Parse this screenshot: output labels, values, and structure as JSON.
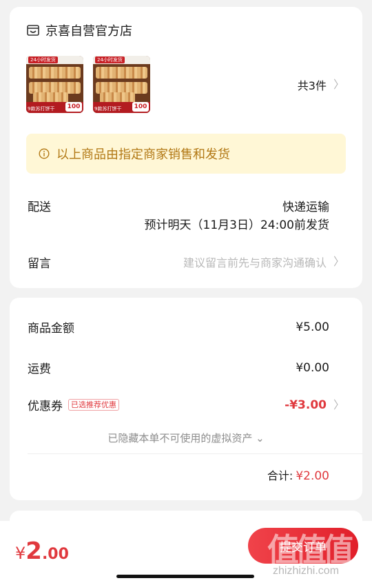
{
  "shop": {
    "name": "京喜自营官方店",
    "icon": "shop-icon",
    "item_count": "共3件",
    "products": [
      {
        "tag": "24小时发货",
        "label": "9款苏打饼干",
        "badge": "100"
      },
      {
        "tag": "24小时发货",
        "label": "9款苏打饼干",
        "badge": "100"
      }
    ]
  },
  "notice": {
    "icon": "info-icon",
    "text": "以上商品由指定商家销售和发货"
  },
  "delivery": {
    "label": "配送",
    "method": "快递运输",
    "time": "预计明天（11月3日）24:00前发货"
  },
  "remark": {
    "label": "留言",
    "placeholder": "建议留言前先与商家沟通确认"
  },
  "price": {
    "goods_label": "商品金额",
    "goods_value": "¥5.00",
    "shipping_label": "运费",
    "shipping_value": "¥0.00",
    "coupon_label": "优惠券",
    "coupon_tag": "已选推荐优惠",
    "coupon_value": "-¥3.00",
    "hidden_assets": "已隐藏本单不可使用的虚拟资产 ⌄",
    "total_label": "合计:",
    "total_value": "¥2.00"
  },
  "footer": {
    "currency": "¥",
    "amount_int": "2",
    "amount_dec": ".00",
    "submit_label": "提交订单"
  },
  "watermark": {
    "logo": "值值值",
    "url": "zhizhizhi.com"
  },
  "colors": {
    "accent": "#e0393e",
    "notice_bg": "#fff7d6",
    "notice_text": "#b27814"
  }
}
